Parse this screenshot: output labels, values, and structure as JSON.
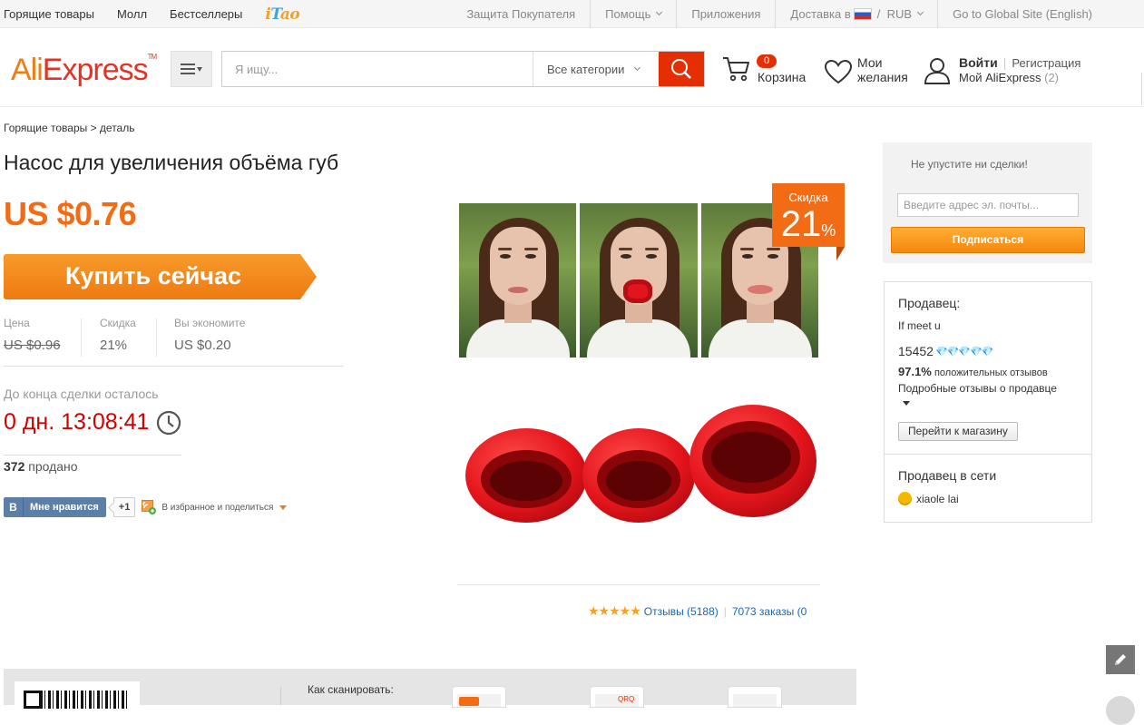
{
  "topbar": {
    "left_links": [
      "Горящие товары",
      "Молл",
      "Бестселлеры"
    ],
    "itao": "iTao",
    "buyer_protection": "Защита Покупателя",
    "help": "Помощь",
    "apps": "Приложения",
    "ship_to": "Доставка в",
    "currency_sep": "/",
    "currency": "RUB",
    "global_site": "Go to Global Site (English)"
  },
  "header": {
    "logo_left": "Ali",
    "logo_right": "Express",
    "logo_tm": "TM",
    "search_placeholder": "Я ищу...",
    "category": "Все категории",
    "cart_count": "0",
    "cart_label": "Корзина",
    "wishlist_label": "Мои желания",
    "login": "Войти",
    "register": "Регистрация",
    "my_account": "Мой AliExpress",
    "my_account_count": "(2)"
  },
  "breadcrumb": "Горящие товары > деталь",
  "product": {
    "title": "Насос для увеличения объёма губ",
    "price": "US $0.76",
    "buy_label": "Купить сейчас",
    "price_label": "Цена",
    "old_price": "US $0.96",
    "discount_label": "Скидка",
    "discount_value": "21%",
    "save_label": "Вы экономите",
    "save_value": "US $0.20",
    "countdown_label": "До конца сделки осталось",
    "countdown": "0 дн. 13:08:41",
    "sold_count": "372",
    "sold_label": "продано",
    "vk_logo": "B",
    "vk_like": "Мне нравится",
    "plus_one": "+1",
    "share_label": "В избранное и поделиться",
    "sale_tag_label": "Скидка",
    "sale_tag_value": "21",
    "sale_tag_pct": "%"
  },
  "rating": {
    "stars": "★★★★★",
    "reviews": "Отзывы (5188)",
    "bar": "|",
    "orders": "7073 заказы (0"
  },
  "subscribe": {
    "hint": "Не упустите ни сделки!",
    "email_placeholder": "Введите адрес эл. почты...",
    "button": "Подписаться"
  },
  "seller": {
    "heading": "Продавец:",
    "name": "If meet u",
    "score": "15452",
    "gems": "💎💎💎💎💎",
    "positive_pct": "97.1%",
    "positive_label": "положительных отзывов",
    "feedback_link": "Подробные отзывы о продавце",
    "store_button": "Перейти к магазину",
    "online_heading": "Продавец в сети",
    "online_name": "xiaole lai"
  },
  "bottom": {
    "how_to_scan": "Как сканировать:",
    "phone_text": "QRQ"
  },
  "colors": {
    "accent_orange": "#f26c16",
    "search_red": "#e62e04",
    "countdown_red": "#d40000",
    "link_blue": "#1a66b3"
  }
}
